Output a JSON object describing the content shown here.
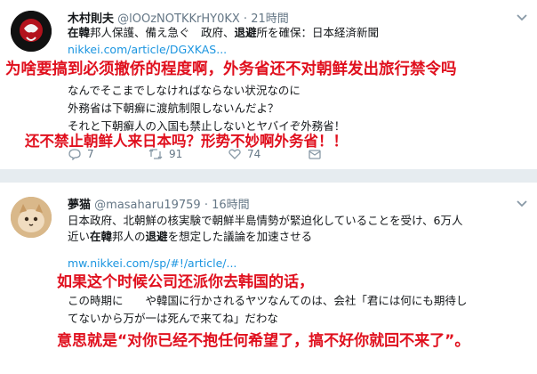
{
  "tweet1": {
    "name": "木村則夫",
    "handle": "@lOOzNOTKKrHY0KX",
    "dot": "·",
    "time": "21時間",
    "headline_prefix": "在韓",
    "headline_mid": "邦人保護、備え急ぐ　政府、",
    "headline_bold": "退避",
    "headline_suffix": "所を確保：日本経済新聞",
    "link": "nikkei.com/article/DGXKAS...",
    "overlay_top": "为啥要搞到必须撤侨的程度啊，外务省还不对朝鲜发出旅行禁令吗",
    "quote_line_1": "なんでそこまでしなければならない状況なのに",
    "quote_line_2": "外務省は下朝癬に渡航制限しないんだよ？",
    "quote_line_3": "それと下朝癬人の入国も禁止しないとヤバイぞ外務省！",
    "overlay_bottom": "还不禁止朝鲜人来日本吗？形势不妙啊外务省！！",
    "reply_count": "7",
    "retweet_count": "91",
    "like_count": "74"
  },
  "tweet2": {
    "name": "夢猫",
    "handle": "@masaharu19759",
    "dot": "·",
    "time": "16時間",
    "body_line_1": "日本政府、北朝鮮の核実験で朝鮮半島情勢が緊迫化していることを受け、6万人",
    "body_line_2_prefix": "近い",
    "body_line_2_bold1": "在韓",
    "body_line_2_mid": "邦人の",
    "body_line_2_bold2": "退避",
    "body_line_2_suffix": "を想定した議論を加速させる",
    "link": "mw.nikkei.com/sp/#!/article/...",
    "overlay_top": "如果这个时候公司还派你去韩国的话，",
    "quote_line_1": "この時期に　　や韓国に行かされるヤツなんてのは、会社「君には何にも期待し",
    "quote_line_2": "てないから万が一は死んで来てね」だわな",
    "overlay_bottom": "意思就是“对你已经不抱任何希望了，搞不好你就回不来了”。"
  },
  "colors": {
    "overlay_red": "#e0101e",
    "link_blue": "#1b95e0",
    "meta_gray": "#657786",
    "separator": "#e6ecf0"
  },
  "icons": [
    "reply-icon",
    "retweet-icon",
    "like-icon",
    "message-icon",
    "chevron-down-icon"
  ]
}
